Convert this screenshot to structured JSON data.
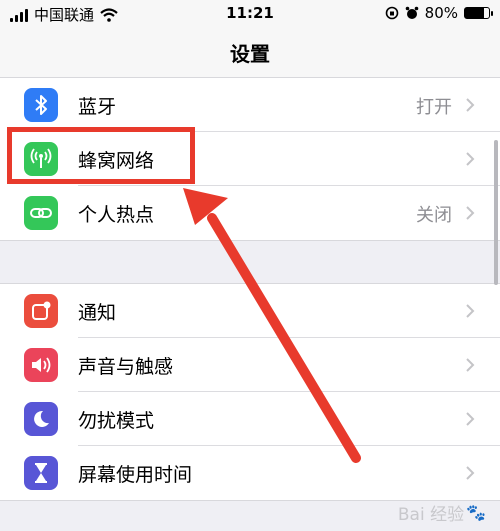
{
  "status_bar": {
    "carrier": "中国联通",
    "time": "11:21",
    "battery_percent": "80%",
    "battery_level": 0.8,
    "icons": [
      "signal-icon",
      "wifi-icon",
      "orientation-lock-icon",
      "alarm-icon",
      "battery-icon"
    ]
  },
  "nav": {
    "title": "设置"
  },
  "group1": [
    {
      "label": "蓝牙",
      "value": "打开",
      "icon": "bluetooth-icon",
      "color": "#2f7cf6"
    },
    {
      "label": "蜂窝网络",
      "value": "",
      "icon": "cellular-antenna-icon",
      "color": "#34c759"
    },
    {
      "label": "个人热点",
      "value": "关闭",
      "icon": "personal-hotspot-icon",
      "color": "#34c759"
    }
  ],
  "group2": [
    {
      "label": "通知",
      "icon": "notifications-icon",
      "color": "#eb4d3d"
    },
    {
      "label": "声音与触感",
      "icon": "sounds-icon",
      "color": "#eb445a"
    },
    {
      "label": "勿扰模式",
      "icon": "do-not-disturb-moon-icon",
      "color": "#5856d6"
    },
    {
      "label": "屏幕使用时间",
      "icon": "screen-time-hourglass-icon",
      "color": "#5856d6"
    }
  ],
  "annotation_color": "#e83a2c",
  "watermark": {
    "text": "Bai 经验",
    "icon": "baidu-paw-icon"
  }
}
